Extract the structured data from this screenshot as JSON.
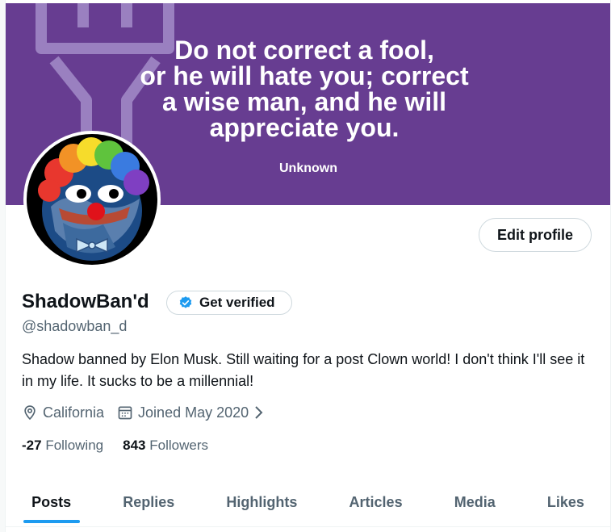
{
  "banner": {
    "quote": "Do not correct a fool,\nor he will hate you; correct\na wise man, and he will\nappreciate you.",
    "author": "Unknown",
    "color": "#673d91"
  },
  "profile": {
    "display_name": "ShadowBan'd",
    "verify_label": "Get verified",
    "handle": "@shadowban_d",
    "bio": "Shadow banned by Elon Musk. Still waiting for a post Clown world! I don't think I'll see it in my life. It sucks to be a millennial!",
    "location": "California",
    "joined": "Joined May 2020",
    "following_count": "-27",
    "following_label": "Following",
    "followers_count": "843",
    "followers_label": "Followers"
  },
  "actions": {
    "edit_profile": "Edit profile"
  },
  "tabs": [
    {
      "label": "Posts",
      "active": true
    },
    {
      "label": "Replies"
    },
    {
      "label": "Highlights"
    },
    {
      "label": "Articles"
    },
    {
      "label": "Media"
    },
    {
      "label": "Likes"
    }
  ],
  "colors": {
    "accent": "#1d9bf0",
    "muted": "#536471",
    "text": "#0f1419"
  }
}
